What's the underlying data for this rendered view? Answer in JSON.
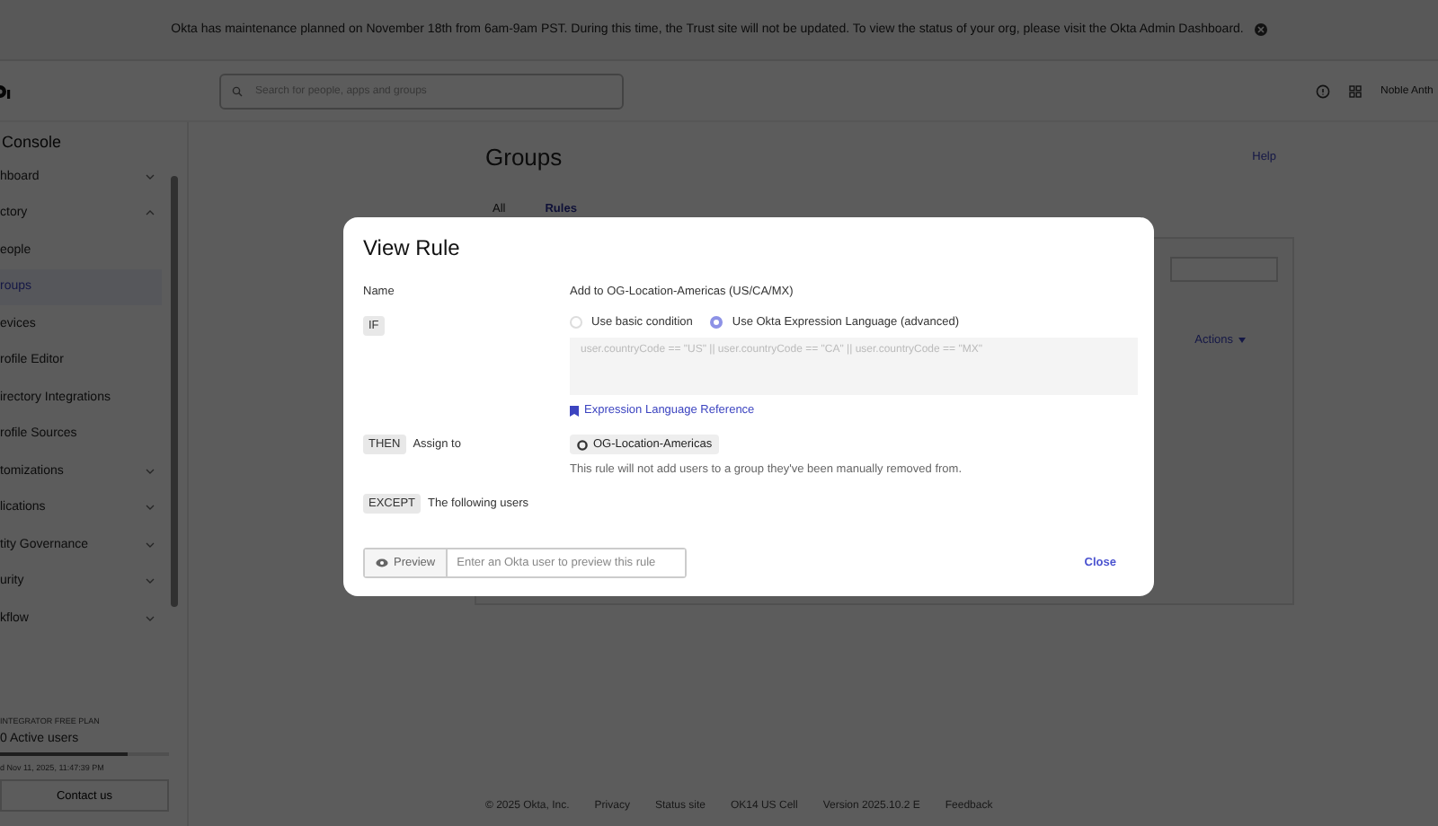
{
  "banner": {
    "text": "Okta has maintenance planned on November 18th from 6am-9am PST. During this time, the Trust site will not be updated. To view the status of your org, please visit the Okta Admin Dashboard."
  },
  "top_bar": {
    "search": {
      "placeholder": "Search for people, apps and groups"
    },
    "user_name": "Noble Anth"
  },
  "sidebar": {
    "title": "Console",
    "items": [
      {
        "label": "hboard",
        "expanded": false,
        "selected": false,
        "kind": "section"
      },
      {
        "label": "ctory",
        "expanded": true,
        "selected": false,
        "kind": "section"
      },
      {
        "label": "eople",
        "selected": false,
        "kind": "link"
      },
      {
        "label": "roups",
        "selected": true,
        "kind": "link"
      },
      {
        "label": "evices",
        "selected": false,
        "kind": "link"
      },
      {
        "label": "rofile Editor",
        "selected": false,
        "kind": "link"
      },
      {
        "label": "irectory Integrations",
        "selected": false,
        "kind": "link"
      },
      {
        "label": "rofile Sources",
        "selected": false,
        "kind": "link"
      },
      {
        "label": "tomizations",
        "expanded": false,
        "selected": false,
        "kind": "section"
      },
      {
        "label": "lications",
        "expanded": false,
        "selected": false,
        "kind": "section"
      },
      {
        "label": "tity Governance",
        "expanded": false,
        "selected": false,
        "kind": "section"
      },
      {
        "label": "urity",
        "expanded": false,
        "selected": false,
        "kind": "section"
      },
      {
        "label": "kflow",
        "expanded": false,
        "selected": false,
        "kind": "section"
      }
    ],
    "plan": "INTEGRATOR FREE PLAN",
    "users": "0 Active users",
    "users_bar": {
      "level": 0.75
    },
    "updated": "d Nov 11, 2025, 11:47:39 PM",
    "contact_button": "Contact us"
  },
  "page": {
    "title": "Groups",
    "help": "Help",
    "tabs": [
      {
        "label": "All",
        "selected": false
      },
      {
        "label": "Rules",
        "selected": true
      }
    ],
    "actions": "Actions"
  },
  "footer": [
    "© 2025 Okta, Inc.",
    "Privacy",
    "Status site",
    "OK14 US Cell",
    "Version 2025.10.2 E",
    "Feedback"
  ],
  "modal": {
    "title": "View Rule",
    "name_label": "Name",
    "name_value": "Add to OG-Location-Americas (US/CA/MX)",
    "if_tag": "IF",
    "conditions": [
      {
        "label": "Use basic condition",
        "selected": false
      },
      {
        "label": "Use Okta Expression Language (advanced)",
        "selected": true
      }
    ],
    "expression": "user.countryCode == \"US\" || user.countryCode == \"CA\" || user.countryCode == \"MX\"",
    "reference_link": "Expression Language Reference",
    "then_tag": "THEN",
    "then_label": "Assign to",
    "group": "OG-Location-Americas",
    "note": "This rule will not add users to a group they've been manually removed from.",
    "except_tag": "EXCEPT",
    "except_label": "The following users",
    "preview_button": "Preview",
    "preview": {
      "placeholder": "Enter an Okta user to preview this rule"
    },
    "close_button": "Close"
  }
}
